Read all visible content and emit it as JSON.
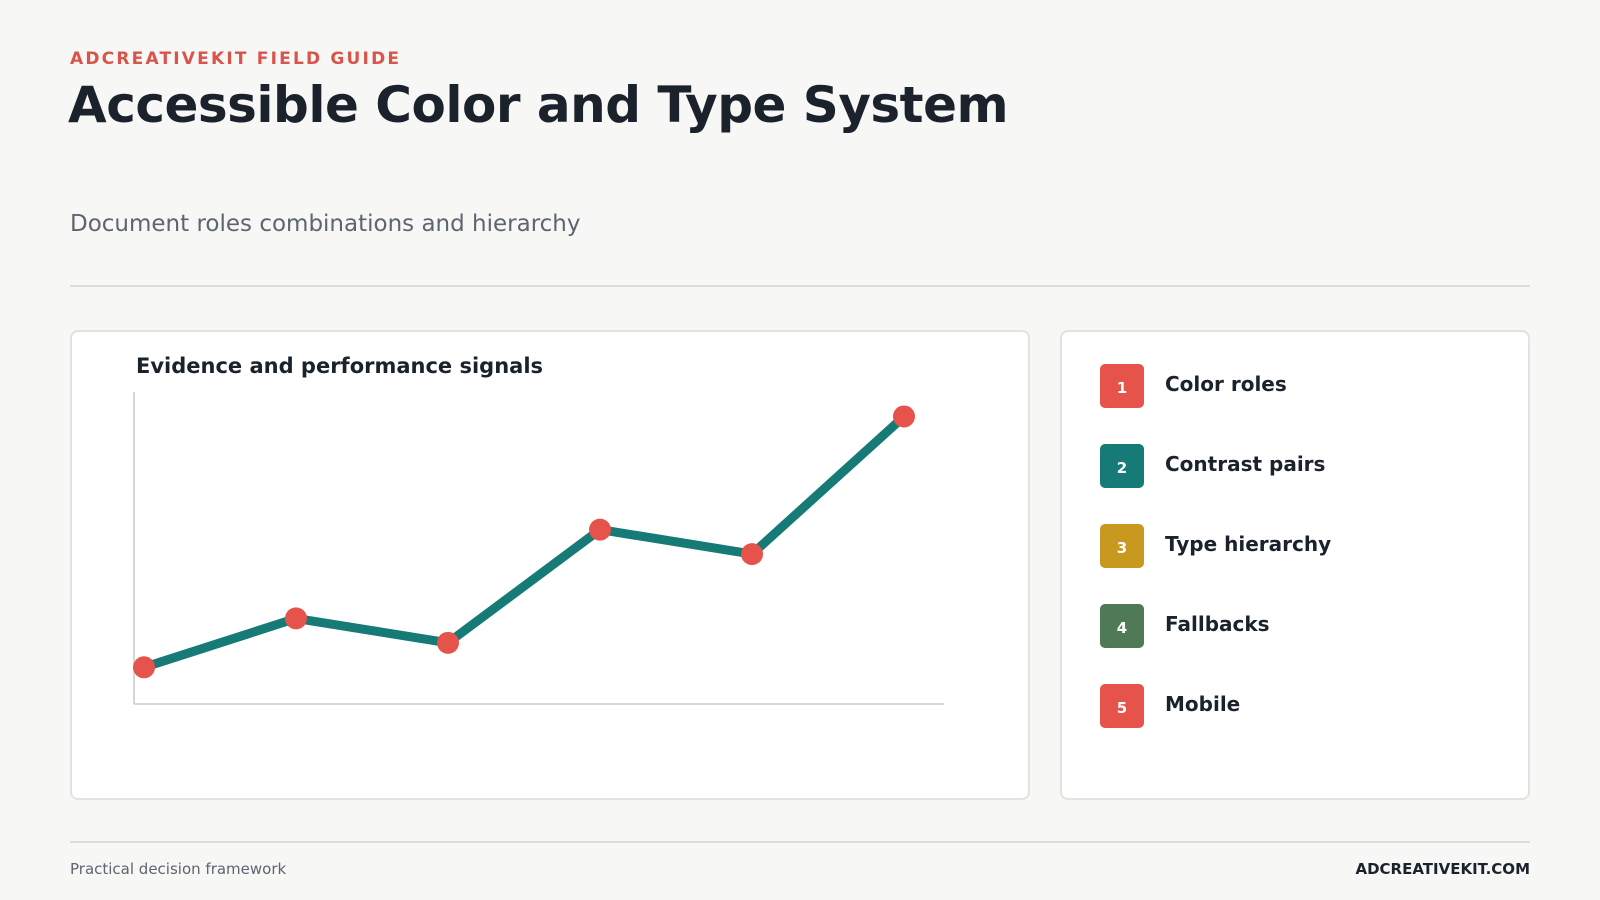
{
  "header": {
    "eyebrow": "ADCREATIVEKIT FIELD GUIDE",
    "title": "Accessible Color and Type System",
    "subtitle": "Document roles combinations and hierarchy"
  },
  "chart_data": {
    "type": "line",
    "title": "Evidence and performance signals",
    "xlabel": "",
    "ylabel": "",
    "x": [
      1,
      2,
      3,
      4,
      5,
      6
    ],
    "series": [
      {
        "values": [
          12,
          28,
          20,
          57,
          49,
          94
        ]
      }
    ],
    "ylim": [
      0,
      102
    ],
    "grid": false,
    "line_color": "#167a76",
    "marker_color": "#e5534b"
  },
  "list": {
    "items": [
      {
        "number": "1",
        "label": "Color roles",
        "color": "#e5534b"
      },
      {
        "number": "2",
        "label": "Contrast pairs",
        "color": "#167a76"
      },
      {
        "number": "3",
        "label": "Type hierarchy",
        "color": "#c9981f"
      },
      {
        "number": "4",
        "label": "Fallbacks",
        "color": "#4f7a55"
      },
      {
        "number": "5",
        "label": "Mobile",
        "color": "#e5534b"
      }
    ]
  },
  "footer": {
    "left": "Practical decision framework",
    "right": "ADCREATIVEKIT.COM"
  }
}
